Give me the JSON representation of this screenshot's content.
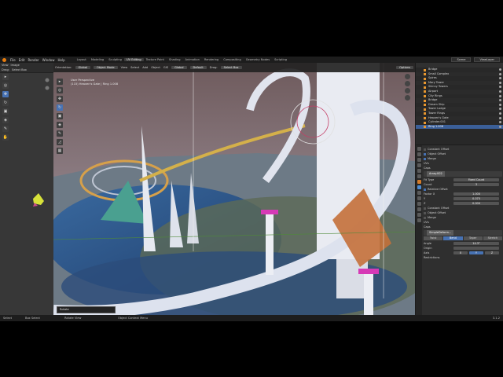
{
  "menu": {
    "items": [
      "File",
      "Edit",
      "Render",
      "Window",
      "Help"
    ],
    "workspaces": [
      "Layout",
      "Modeling",
      "Sculpting",
      "UV Editing",
      "Texture Paint",
      "Shading",
      "Animation",
      "Rendering",
      "Compositing",
      "Geometry Nodes",
      "Scripting"
    ],
    "active_workspace": "UV Editing",
    "scene": "Scene",
    "view_layer": "ViewLayer"
  },
  "uv_editor": {
    "header": [
      "View",
      "Image"
    ],
    "mode_row": [
      "Drag:",
      "Select Box"
    ]
  },
  "viewport": {
    "header": {
      "orientation_label": "Orientation:",
      "orientation": "Global",
      "mode": "Object Mode",
      "menus": [
        "View",
        "Select",
        "Add",
        "Object",
        "GIS"
      ],
      "default": "Default",
      "drag_label": "Drag:",
      "drag": "Select Box",
      "pivot": "Global",
      "options": "Options"
    },
    "info_line1": "User Perspective",
    "info_line2": "(115) Heaven's Gate | Ring 1.008",
    "last_operator": "Rotate"
  },
  "outliner": {
    "items": [
      "Bridge",
      "Small Complex",
      "Spires",
      "Mary Tower",
      "Skinny Towers",
      "Airport",
      "City Rings",
      "Bridge",
      "Dream Ship",
      "Tower Lodge",
      "Tower Rings",
      "Heaven's Gate",
      "Cylinder.001",
      "Ring 1.008"
    ],
    "selected": "Ring 1.008"
  },
  "properties": {
    "constant_offset": "Constant Offset",
    "object_offset": "Object Offset",
    "merge": "Merge",
    "uvs": "UVs",
    "caps": "Caps",
    "array_name": "Array.002",
    "fit_type_label": "Fit Type",
    "fit_type": "Fixed Count",
    "count_label": "Count",
    "count": "3",
    "relative_offset": "Relative Offset",
    "factor_x_label": "Factor X",
    "factor_x": "1.000",
    "factor_y_label": "Y",
    "factor_y": "0.075",
    "factor_z_label": "Z",
    "factor_z": "0.000",
    "simple_deform_name": "SimpleDeform...",
    "deform_tabs": [
      "Twist",
      "Bend",
      "Taper",
      "Stretch"
    ],
    "deform_active": "Bend",
    "angle_label": "Angle",
    "angle": "14.3°",
    "origin_label": "Origin",
    "axis_label": "Axis",
    "axis_options": [
      "X",
      "Y",
      "Z"
    ],
    "axis_active": "Y",
    "restrictions": "Restrictions"
  },
  "status": {
    "left1": "Select",
    "left2": "Box Select",
    "mid1": "Rotate View",
    "mid2": "Object Context Menu",
    "version": "3.1.2"
  }
}
